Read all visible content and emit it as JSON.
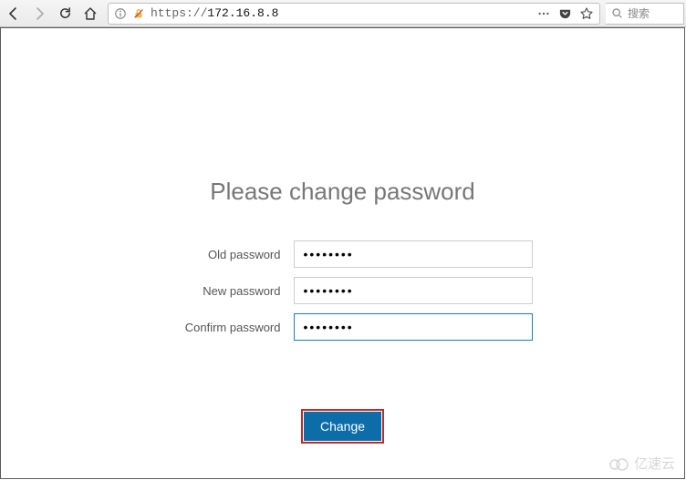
{
  "toolbar": {
    "url_prefix": "https://",
    "url_host": "172.16.8.8",
    "search_placeholder": "搜索"
  },
  "main": {
    "title": "Please change password",
    "fields": {
      "old": {
        "label": "Old password",
        "value": "••••••••"
      },
      "new": {
        "label": "New password",
        "value": "••••••••"
      },
      "confirm": {
        "label": "Confirm password",
        "value": "••••••••"
      }
    },
    "submit_label": "Change"
  },
  "watermark": "亿速云"
}
